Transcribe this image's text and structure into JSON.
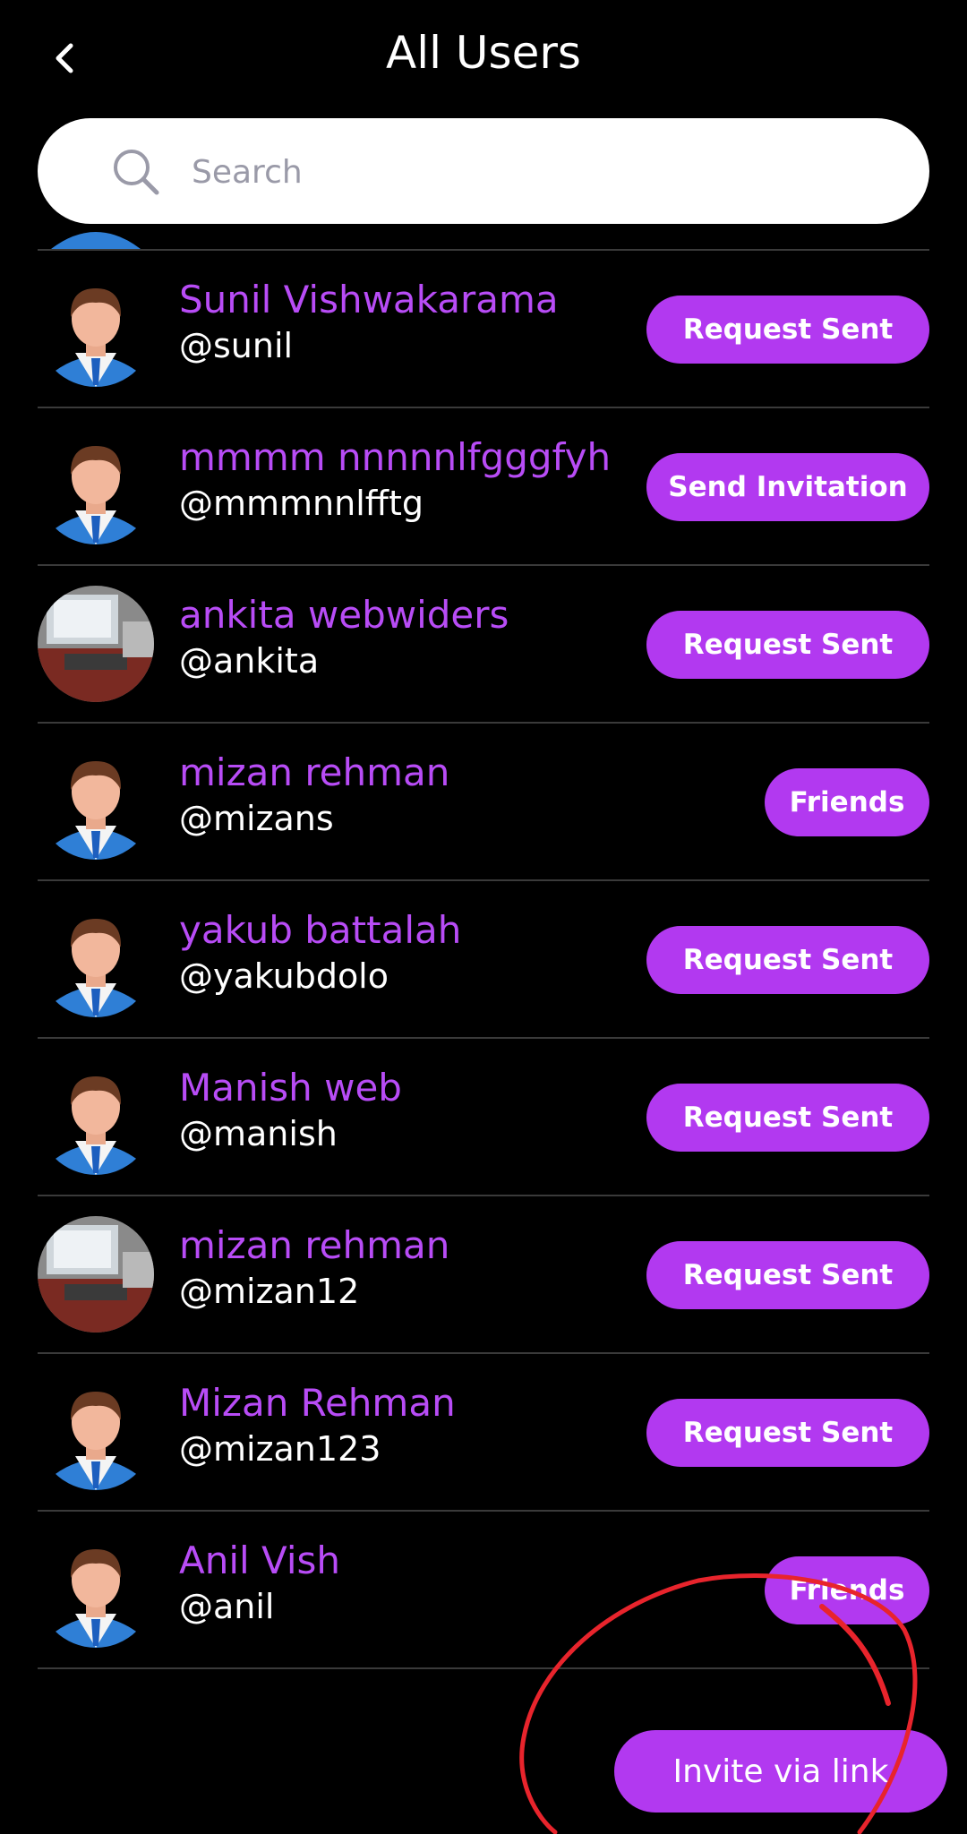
{
  "header": {
    "title": "All Users"
  },
  "search": {
    "placeholder": "Search"
  },
  "users": [
    {
      "name": "Sunil Vishwakarama",
      "handle": "@sunil",
      "action": "Request Sent",
      "avatar": "default-avatar"
    },
    {
      "name": "mmmm nnnnnlfgggfyh",
      "handle": "@mmmnnlfftg",
      "action": "Send Invitation",
      "avatar": "default-avatar"
    },
    {
      "name": "ankita webwiders",
      "handle": "@ankita",
      "action": "Request Sent",
      "avatar": "photo-avatar"
    },
    {
      "name": "mizan rehman",
      "handle": "@mizans",
      "action": "Friends",
      "avatar": "default-avatar"
    },
    {
      "name": "yakub battalah",
      "handle": "@yakubdolo",
      "action": "Request Sent",
      "avatar": "default-avatar"
    },
    {
      "name": "Manish web",
      "handle": "@manish",
      "action": "Request Sent",
      "avatar": "default-avatar"
    },
    {
      "name": "mizan rehman",
      "handle": "@mizan12",
      "action": "Request Sent",
      "avatar": "photo-avatar"
    },
    {
      "name": "Mizan Rehman",
      "handle": "@mizan123",
      "action": "Request Sent",
      "avatar": "default-avatar"
    },
    {
      "name": "Anil Vish",
      "handle": "@anil",
      "action": "Friends",
      "avatar": "default-avatar"
    }
  ],
  "footer": {
    "invite_label": "Invite via link"
  },
  "colors": {
    "accent": "#b239f0",
    "name_text": "#b84cf6",
    "background": "#000000",
    "annotation": "#e8242c"
  }
}
